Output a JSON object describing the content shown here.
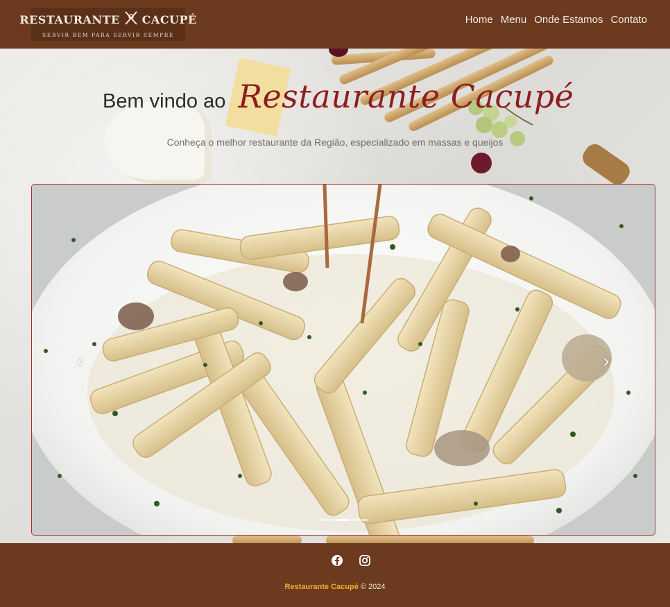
{
  "header": {
    "logo_title_left": "RESTAURANTE",
    "logo_title_right": "CACUPÉ",
    "logo_subtitle": "SERVIR BEM PARA SERVIR SEMPRE",
    "nav": [
      {
        "label": "Home"
      },
      {
        "label": "Menu"
      },
      {
        "label": "Onde Estamos"
      },
      {
        "label": "Contato"
      }
    ]
  },
  "hero": {
    "welcome_text": "Bem vindo ao",
    "restaurant_name": "Restaurante Cacupé",
    "tagline": "Conheça o melhor restaurante da Região, especializado em massas e queijos"
  },
  "carousel": {
    "prev_icon": "chevron-left-icon",
    "next_icon": "chevron-right-icon",
    "slide_count": 3,
    "active_slide": 2
  },
  "footer": {
    "social_icons": [
      "facebook-icon",
      "instagram-icon"
    ],
    "brand": "Restaurante Cacupé",
    "copyright": "© 2024"
  },
  "colors": {
    "header_bg": "#6b3a1f",
    "script_accent": "#8e1d20",
    "footer_brand": "#f2b12e"
  }
}
